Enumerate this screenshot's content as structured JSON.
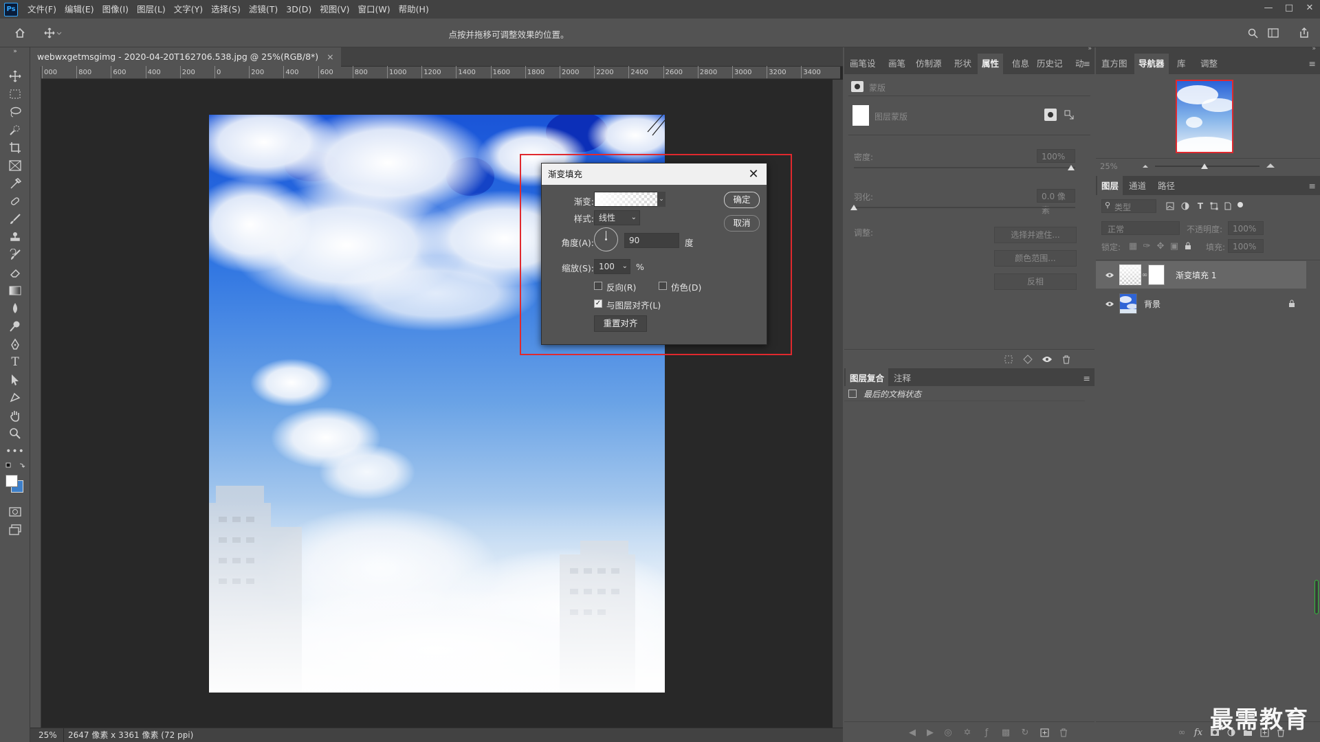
{
  "app": {
    "logo": "Ps"
  },
  "menu": [
    "文件(F)",
    "编辑(E)",
    "图像(I)",
    "图层(L)",
    "文字(Y)",
    "选择(S)",
    "滤镜(T)",
    "3D(D)",
    "视图(V)",
    "窗口(W)",
    "帮助(H)"
  ],
  "options_bar": {
    "hint": "点按并拖移可调整效果的位置。"
  },
  "document": {
    "tab_title": "webwxgetmsgimg - 2020-04-20T162706.538.jpg @ 25%(RGB/8*)",
    "tab_close": "×",
    "ruler_h": [
      "000",
      "800",
      "600",
      "400",
      "200",
      "0",
      "200",
      "400",
      "600",
      "800",
      "1000",
      "1200",
      "1400",
      "1600",
      "1800",
      "2000",
      "2200",
      "2400",
      "2600",
      "2800",
      "3000",
      "3200",
      "3400"
    ],
    "zoom": "25%",
    "dims": "2647 像素 x 3361 像素 (72 ppi)"
  },
  "dialog": {
    "title": "渐变填充",
    "gradient_label": "渐变:",
    "style_label": "样式:",
    "style_value": "线性",
    "angle_label": "角度(A):",
    "angle_value": "90",
    "angle_unit": "度",
    "scale_label": "缩放(S):",
    "scale_value": "100",
    "scale_unit": "%",
    "reverse": {
      "label": "反向(R)",
      "checked": false
    },
    "dither": {
      "label": "仿色(D)",
      "checked": false
    },
    "align": {
      "label": "与图层对齐(L)",
      "checked": true
    },
    "reset_align": "重置对齐",
    "ok": "确定",
    "cancel": "取消"
  },
  "properties_panel": {
    "tabs": [
      "画笔设",
      "画笔",
      "仿制源",
      "形状",
      "属性",
      "信息",
      "历史记",
      "动作"
    ],
    "active_tab": "属性",
    "header": "蒙版",
    "mask_label": "图层蒙版",
    "density_label": "密度:",
    "density_value": "100%",
    "feather_label": "羽化:",
    "feather_value": "0.0 像素",
    "adjust_label": "调整:",
    "select_mask_btn": "选择并遮住...",
    "color_range_btn": "颜色范围...",
    "invert_btn": "反相"
  },
  "comps_panel": {
    "tabs": [
      "图层复合",
      "注释"
    ],
    "item": "最后的文档状态"
  },
  "navigator_panel": {
    "tabs": [
      "直方图",
      "导航器",
      "库",
      "调整"
    ],
    "zoom": "25%"
  },
  "layers_panel": {
    "tabs": [
      "图层",
      "通道",
      "路径"
    ],
    "filter_placeholder": "类型",
    "blend_mode": "正常",
    "opacity_label": "不透明度:",
    "opacity_value": "100%",
    "lock_label": "锁定:",
    "fill_label": "填充:",
    "fill_value": "100%",
    "layers": [
      {
        "name": "渐变填充 1"
      },
      {
        "name": "背景"
      }
    ]
  },
  "watermark": "最需教育",
  "colors": {
    "accent_red": "#e0292e",
    "selection_blue": "#31a8ff"
  }
}
